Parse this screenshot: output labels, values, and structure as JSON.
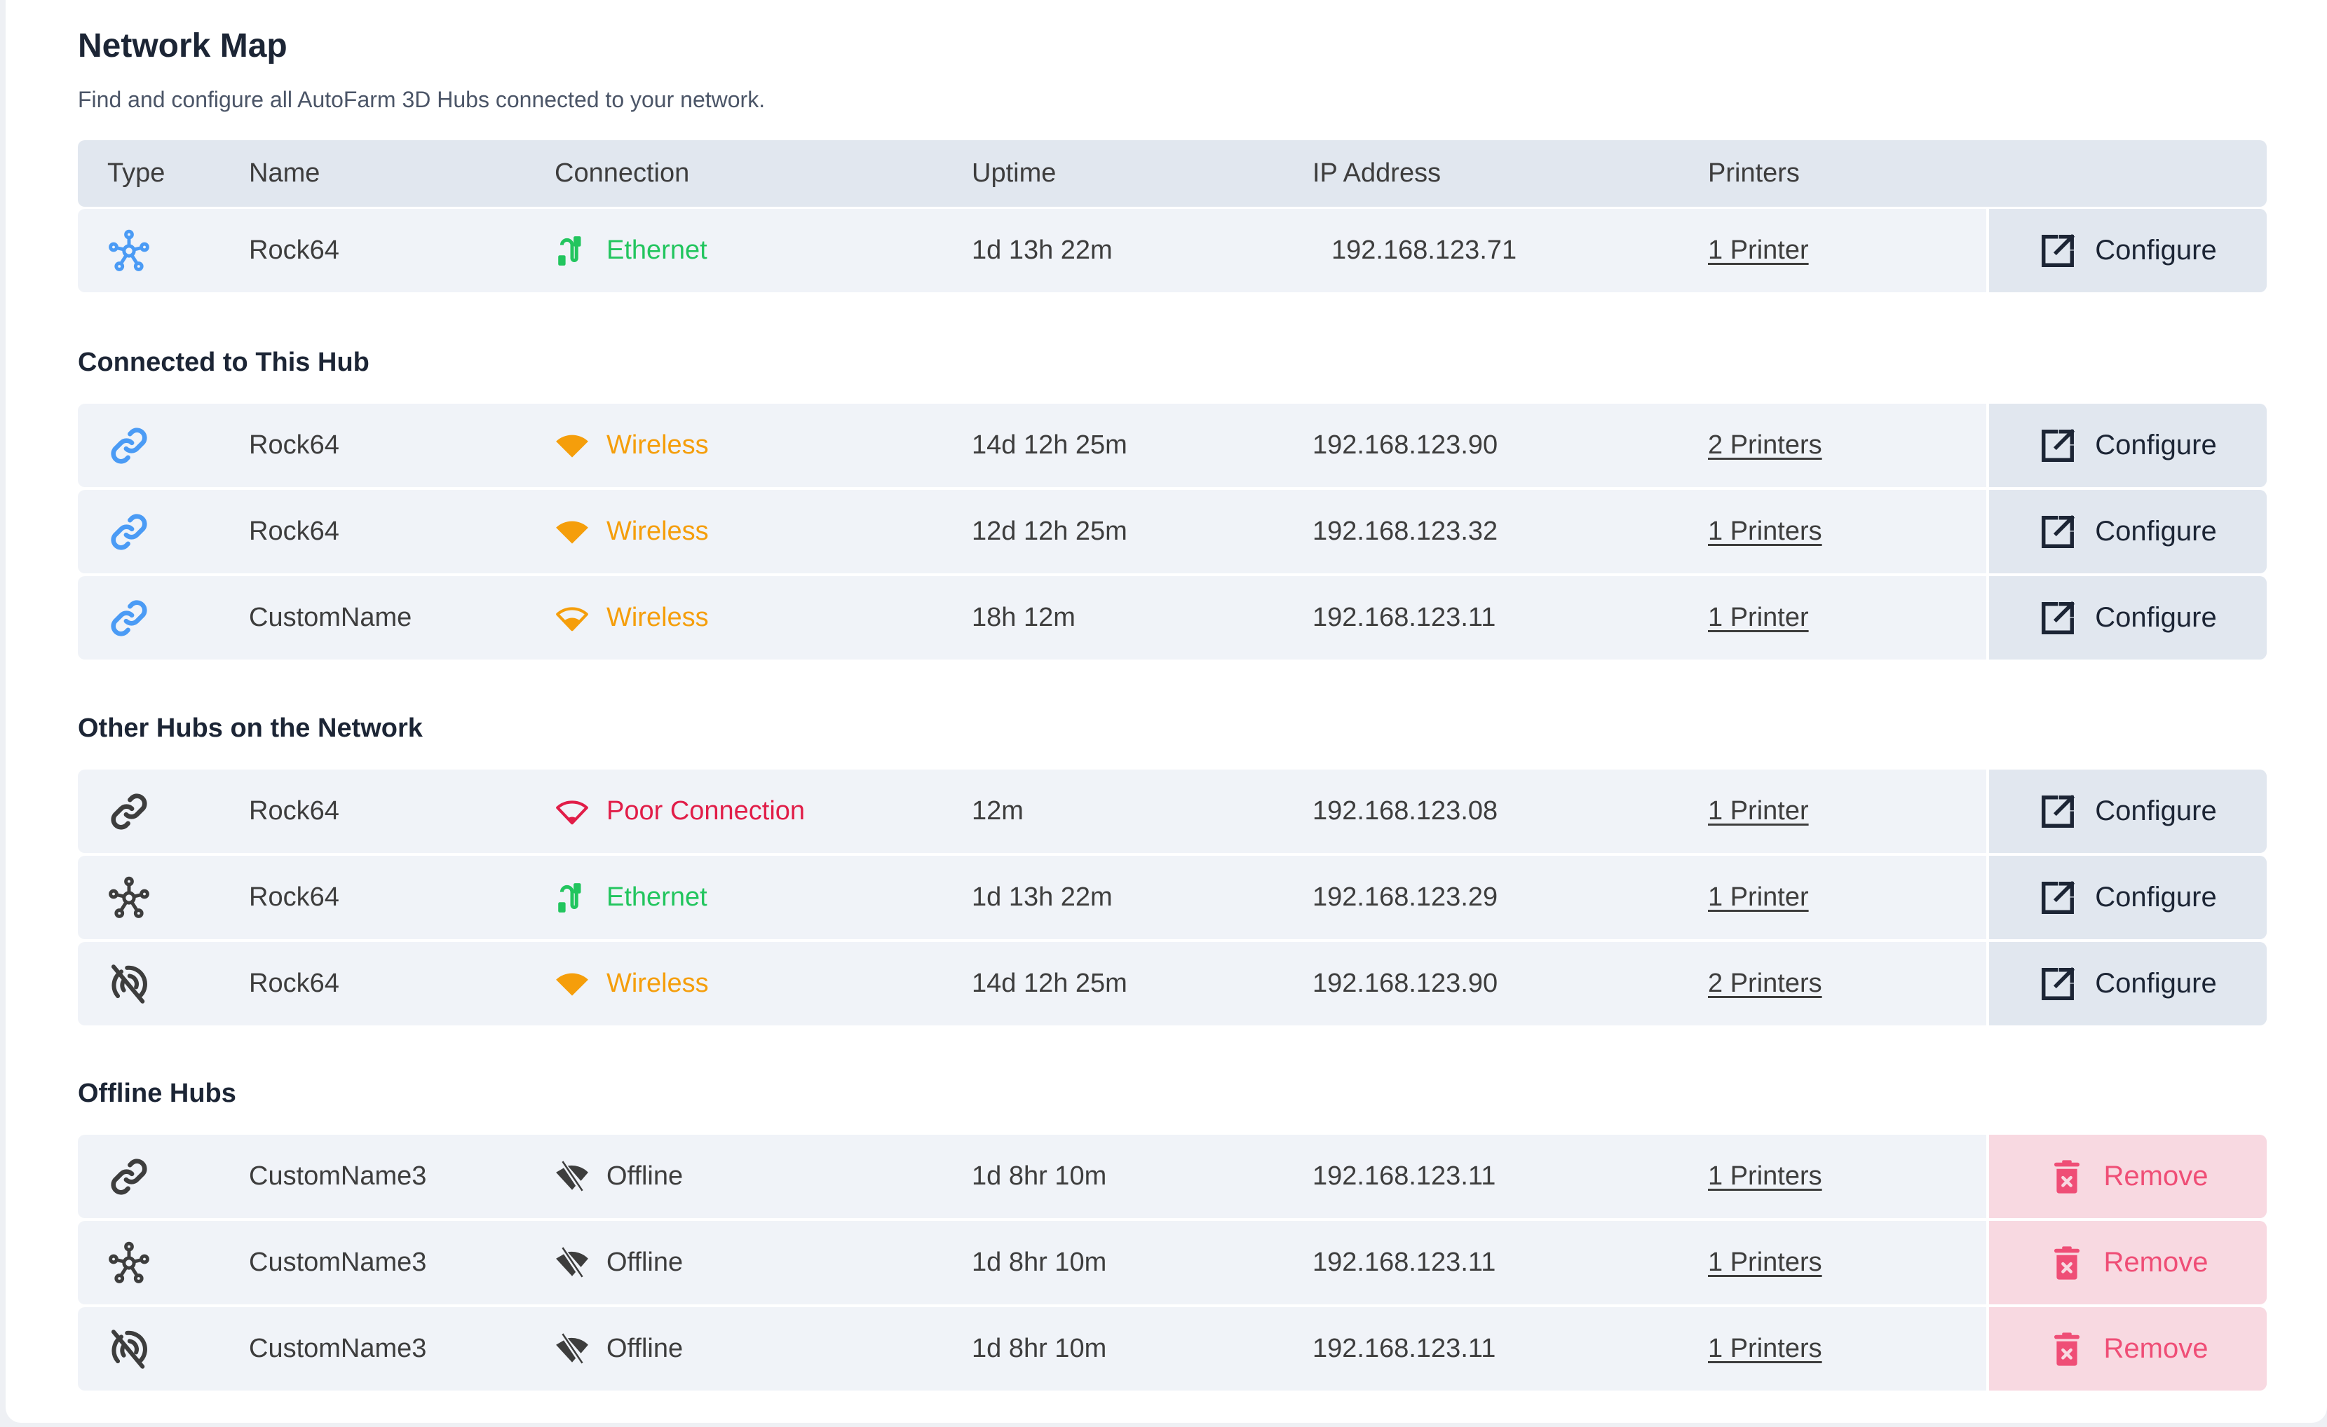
{
  "page": {
    "title": "Network Map",
    "subtitle": "Find and configure all AutoFarm 3D Hubs connected to your network."
  },
  "colors": {
    "ethernet": "#22c55e",
    "wireless": "#f59e0b",
    "poor": "#e11d48",
    "offline": "#3d3d3d",
    "type_active": "#4b9bf5",
    "type_inactive": "#3d3d3d",
    "remove": "#ef4e76"
  },
  "table": {
    "columns": [
      "Type",
      "Name",
      "Connection",
      "Uptime",
      "IP Address",
      "Printers"
    ]
  },
  "current_hub": {
    "type_icon": "hub-icon",
    "name": "Rock64",
    "connection": "Ethernet",
    "connection_icon": "ethernet-cable-icon",
    "uptime": "1d 13h 22m",
    "ip": "192.168.123.71",
    "printers": "1 Printer",
    "action": "Configure"
  },
  "sections": [
    {
      "title": "Connected to This Hub",
      "rows": [
        {
          "type_icon": "link-icon",
          "name": "Rock64",
          "connection": "Wireless",
          "connection_icon": "wifi-full-icon",
          "uptime": "14d 12h 25m",
          "ip": "192.168.123.90",
          "printers": "2 Printers",
          "action": "Configure"
        },
        {
          "type_icon": "link-icon",
          "name": "Rock64",
          "connection": "Wireless",
          "connection_icon": "wifi-full-icon",
          "uptime": "12d 12h 25m",
          "ip": "192.168.123.32",
          "printers": "1 Printers",
          "action": "Configure"
        },
        {
          "type_icon": "link-icon",
          "name": "CustomName",
          "connection": "Wireless",
          "connection_icon": "wifi-medium-icon",
          "uptime": "18h 12m",
          "ip": "192.168.123.11",
          "printers": "1 Printer",
          "action": "Configure"
        }
      ]
    },
    {
      "title": "Other Hubs on the Network",
      "rows": [
        {
          "type_icon": "link-icon",
          "name": "Rock64",
          "connection": "Poor Connection",
          "connection_icon": "wifi-weak-icon",
          "uptime": "12m",
          "ip": "192.168.123.08",
          "printers": "1 Printer",
          "action": "Configure"
        },
        {
          "type_icon": "hub-icon",
          "name": "Rock64",
          "connection": "Ethernet",
          "connection_icon": "ethernet-cable-icon",
          "uptime": "1d 13h 22m",
          "ip": "192.168.123.29",
          "printers": "1 Printer",
          "action": "Configure"
        },
        {
          "type_icon": "broadcast-off-icon",
          "name": "Rock64",
          "connection": "Wireless",
          "connection_icon": "wifi-full-icon",
          "uptime": "14d 12h 25m",
          "ip": "192.168.123.90",
          "printers": "2 Printers",
          "action": "Configure"
        }
      ]
    },
    {
      "title": "Offline Hubs",
      "rows": [
        {
          "type_icon": "link-icon",
          "name": "CustomName3",
          "connection": "Offline",
          "connection_icon": "wifi-off-icon",
          "uptime": "1d 8hr 10m",
          "ip": "192.168.123.11",
          "printers": "1 Printers",
          "action": "Remove"
        },
        {
          "type_icon": "hub-icon",
          "name": "CustomName3",
          "connection": "Offline",
          "connection_icon": "wifi-off-icon",
          "uptime": "1d 8hr 10m",
          "ip": "192.168.123.11",
          "printers": "1 Printers",
          "action": "Remove"
        },
        {
          "type_icon": "broadcast-off-icon",
          "name": "CustomName3",
          "connection": "Offline",
          "connection_icon": "wifi-off-icon",
          "uptime": "1d 8hr 10m",
          "ip": "192.168.123.11",
          "printers": "1 Printers",
          "action": "Remove"
        }
      ]
    }
  ]
}
